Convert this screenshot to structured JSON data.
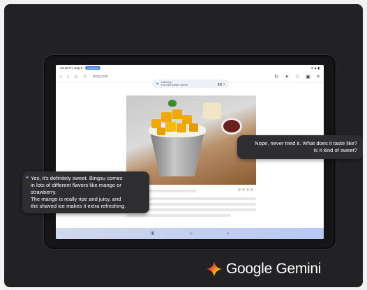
{
  "status": {
    "time": "10:10 Fri, Sep 5",
    "rec_badge": "● Screen",
    "icons": "● ▲ ▮"
  },
  "browser": {
    "url": "bsng.com",
    "nav_icons": [
      "‹",
      "›",
      "⌂",
      "☆"
    ],
    "right_icons": [
      "↻",
      "✦",
      "☆",
      "▣",
      "≡"
    ]
  },
  "listening_pill": {
    "line1": "Listening...",
    "line2": "Live with Google Gemini",
    "controls": "❚❚ ✕"
  },
  "bottom_nav": {
    "recent": "III",
    "home": "○",
    "back": "‹"
  },
  "chat": {
    "user_line1": "Nope, never tried it. What does it taste like?",
    "user_line2": "Is it kind of sweet?",
    "ai_line1": "Yes, it's definitely sweet. Bingsu comes",
    "ai_line2": "in lots of different flavors like mango or",
    "ai_line3": "strawberry.",
    "ai_line4": "The mango is really ripe and juicy, and",
    "ai_line5": "the shaved ice makes it extra refreshing.",
    "spark_icon": "✦"
  },
  "brand": {
    "name": "Google Gemini",
    "colors": [
      "#4285f4",
      "#ea4335",
      "#fbbc04",
      "#34a853"
    ]
  }
}
